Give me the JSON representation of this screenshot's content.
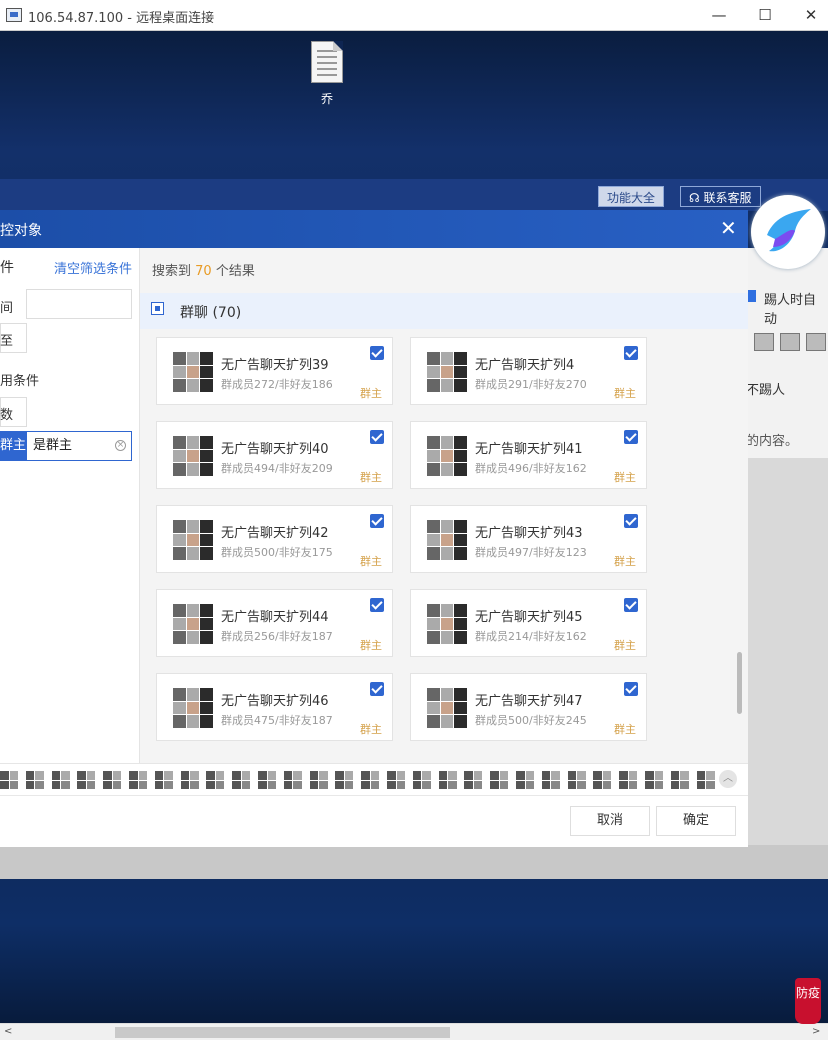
{
  "remote_window": {
    "title": "106.54.87.100 - 远程桌面连接",
    "minimize": "—",
    "maximize": "☐",
    "close": "✕"
  },
  "desktop": {
    "file_label": "乔"
  },
  "app": {
    "feature_button": "功能大全",
    "support_button": "联系客服"
  },
  "background_panel": {
    "checkbox_label": "踢人时自动",
    "no_kick": "不踢人",
    "content_text": "的内容。"
  },
  "dialog": {
    "title": "控对象",
    "close": "✕",
    "left": {
      "heading": "件",
      "clear_filters": "清空筛选条件",
      "row1_label": "间",
      "row2_label": "至",
      "common_conditions": "用条件",
      "count_label": "数",
      "active_filter_tag": "群主",
      "active_filter_value": "是群主"
    },
    "search_result": {
      "prefix": "搜索到",
      "count": "70",
      "suffix": "个结果"
    },
    "group": {
      "label": "群聊 (70)"
    },
    "cards": [
      {
        "name": "无广告聊天扩列39",
        "stats": "群成员272/非好友186",
        "role": "群主"
      },
      {
        "name": "无广告聊天扩列4",
        "stats": "群成员291/非好友270",
        "role": "群主"
      },
      {
        "name": "无广告聊天扩列40",
        "stats": "群成员494/非好友209",
        "role": "群主"
      },
      {
        "name": "无广告聊天扩列41",
        "stats": "群成员496/非好友162",
        "role": "群主"
      },
      {
        "name": "无广告聊天扩列42",
        "stats": "群成员500/非好友175",
        "role": "群主"
      },
      {
        "name": "无广告聊天扩列43",
        "stats": "群成员497/非好友123",
        "role": "群主"
      },
      {
        "name": "无广告聊天扩列44",
        "stats": "群成员256/非好友187",
        "role": "群主"
      },
      {
        "name": "无广告聊天扩列45",
        "stats": "群成员214/非好友162",
        "role": "群主"
      },
      {
        "name": "无广告聊天扩列46",
        "stats": "群成员475/非好友187",
        "role": "群主"
      },
      {
        "name": "无广告聊天扩列47",
        "stats": "群成员500/非好友245",
        "role": "群主"
      }
    ],
    "buttons": {
      "cancel": "取消",
      "confirm": "确定"
    }
  },
  "badge": {
    "text": "防疫"
  },
  "colors": {
    "accent_blue": "#2f66d0",
    "result_count": "#e89b25",
    "role_tag": "#d5a24c",
    "badge_red": "#c8102e"
  }
}
